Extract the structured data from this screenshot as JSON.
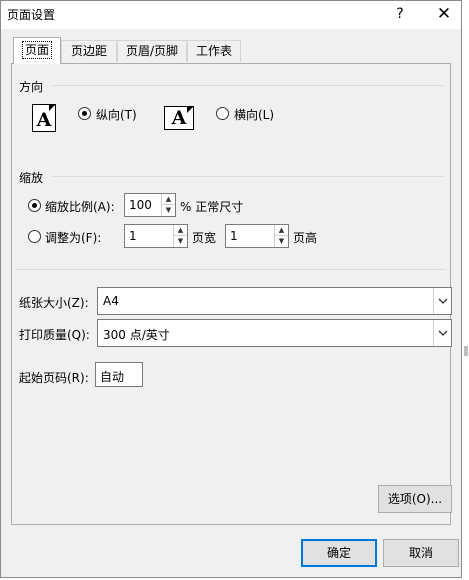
{
  "window": {
    "title": "页面设置",
    "help": "?",
    "close": "✕"
  },
  "tabs": [
    {
      "label": "页面",
      "active": true
    },
    {
      "label": "页边距",
      "active": false
    },
    {
      "label": "页眉/页脚",
      "active": false
    },
    {
      "label": "工作表",
      "active": false
    }
  ],
  "orientation": {
    "label": "方向",
    "portrait_label": "纵向(T)",
    "landscape_label": "横向(L)",
    "icon_glyph": "A",
    "selected": "portrait"
  },
  "scaling": {
    "label": "缩放",
    "adjust_label": "缩放比例(A):",
    "adjust_value": "100",
    "adjust_suffix": "% 正常尺寸",
    "fit_label": "调整为(F):",
    "pages_wide_value": "1",
    "pages_wide_label": "页宽",
    "pages_tall_value": "1",
    "pages_tall_label": "页高",
    "selected": "adjust"
  },
  "paper_size": {
    "label": "纸张大小(Z):",
    "value": "A4"
  },
  "print_quality": {
    "label": "打印质量(Q):",
    "value": "300 点/英寸"
  },
  "first_page_number": {
    "label": "起始页码(R):",
    "value": "自动"
  },
  "buttons": {
    "options": "选项(O)...",
    "ok": "确定",
    "cancel": "取消"
  },
  "icons": {
    "spin_up": "▲",
    "spin_down": "▼"
  }
}
